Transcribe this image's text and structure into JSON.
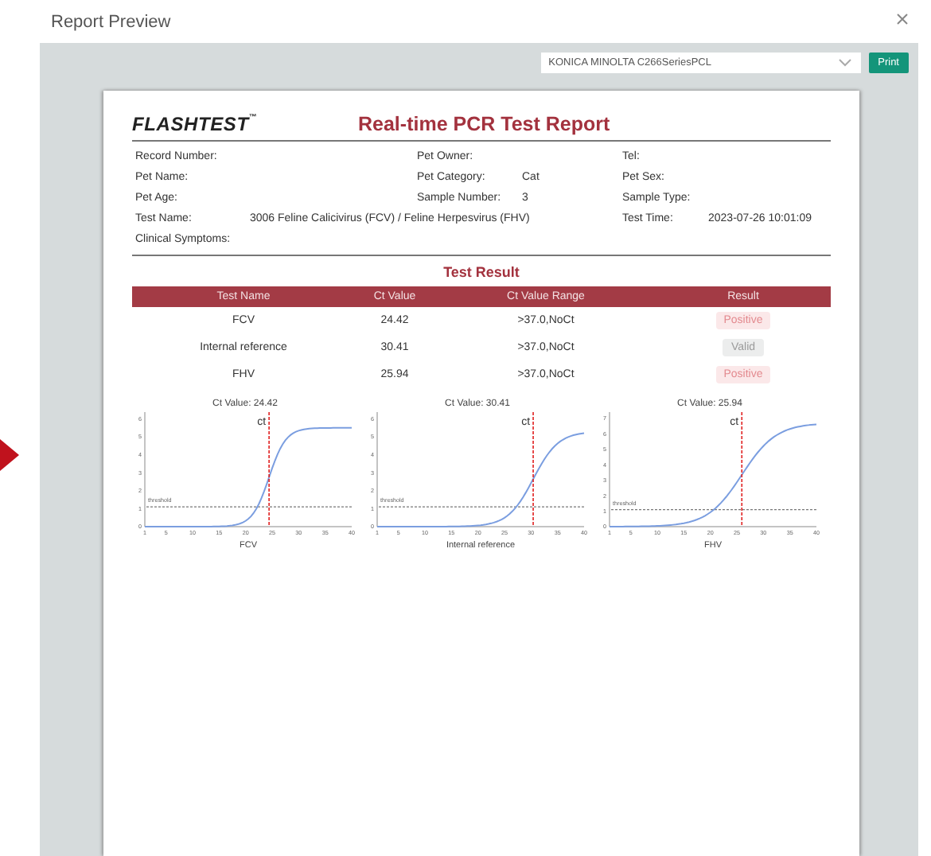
{
  "window": {
    "title": "Report Preview"
  },
  "toolbar": {
    "printer": "KONICA MINOLTA C266SeriesPCL",
    "print_button": "Print"
  },
  "report": {
    "logo": "FLASHTEST",
    "logo_mark": "™",
    "title": "Real-time PCR Test Report",
    "info_rows": [
      [
        {
          "label": "Record Number:"
        },
        {
          "label": "Pet Owner:"
        },
        {
          "label": "Tel:"
        }
      ],
      [
        {
          "label": "Pet Name:"
        },
        {
          "label": "Pet Category:",
          "value": "Cat"
        },
        {
          "label": "Pet Sex:"
        }
      ],
      [
        {
          "label": "Pet Age:"
        },
        {
          "label": "Sample Number:",
          "value": "3"
        },
        {
          "label": "Sample Type:"
        }
      ],
      [
        {
          "label": "Test Name:",
          "value": "3006 Feline Calicivirus (FCV) / Feline Herpesvirus (FHV)"
        },
        {
          "label": "Test Time:",
          "value": "2023-07-26 10:01:09"
        }
      ],
      [
        {
          "label": "Clinical Symptoms:"
        }
      ]
    ],
    "result_title": "Test Result",
    "table": {
      "columns": [
        "Test Name",
        "Ct Value",
        "Ct Value Range",
        "Result"
      ],
      "rows": [
        {
          "name": "FCV",
          "ct": "24.42",
          "range": ">37.0,NoCt",
          "result": "Positive",
          "kind": "positive"
        },
        {
          "name": "Internal reference",
          "ct": "30.41",
          "range": ">37.0,NoCt",
          "result": "Valid",
          "kind": "valid"
        },
        {
          "name": "FHV",
          "ct": "25.94",
          "range": ">37.0,NoCt",
          "result": "Positive",
          "kind": "positive"
        }
      ]
    },
    "charts": [
      {
        "title": "Ct Value:  24.42",
        "ct_label": "ct",
        "threshold_label": "threshold",
        "xlabel": "FCV",
        "yticks": [
          "6",
          "5",
          "4",
          "3",
          "2",
          "1",
          "0"
        ],
        "xticks": [
          "1",
          "5",
          "10",
          "15",
          "20",
          "25",
          "30",
          "35",
          "40"
        ]
      },
      {
        "title": "Ct Value:  30.41",
        "ct_label": "ct",
        "threshold_label": "threshold",
        "xlabel": "Internal reference",
        "yticks": [
          "6",
          "5",
          "4",
          "3",
          "2",
          "1",
          "0"
        ],
        "xticks": [
          "1",
          "5",
          "10",
          "15",
          "20",
          "25",
          "30",
          "35",
          "40"
        ]
      },
      {
        "title": "Ct Value:  25.94",
        "ct_label": "ct",
        "threshold_label": "threshold",
        "xlabel": "FHV",
        "yticks": [
          "7",
          "6",
          "5",
          "4",
          "3",
          "2",
          "1",
          "0"
        ],
        "xticks": [
          "1",
          "5",
          "10",
          "15",
          "20",
          "25",
          "30",
          "35",
          "40"
        ]
      }
    ]
  }
}
